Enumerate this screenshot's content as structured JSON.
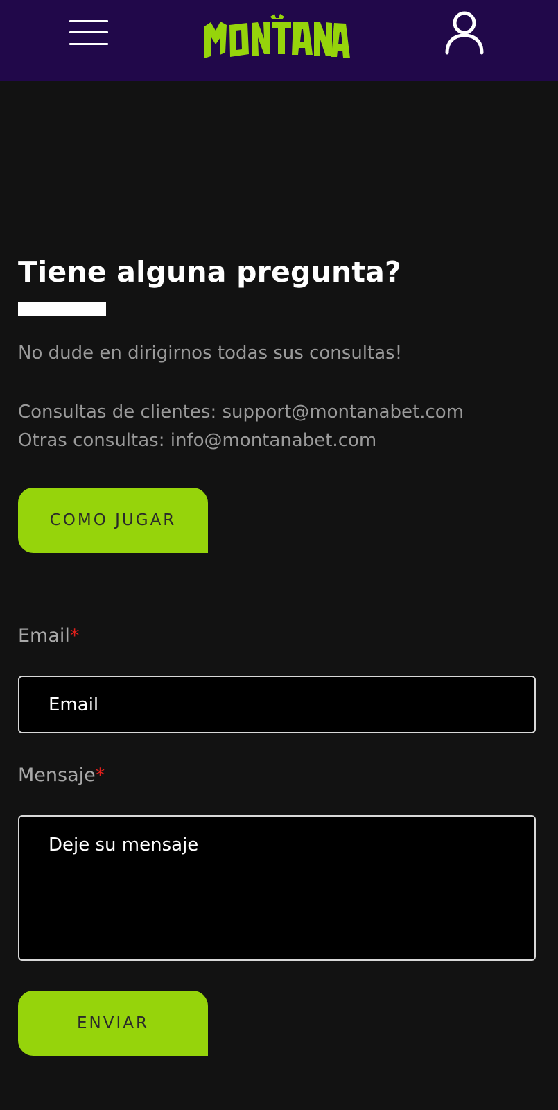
{
  "header": {
    "brand": "MONTANA",
    "menu_icon": "hamburger-menu-icon",
    "user_icon": "user-account-icon",
    "brand_color": "#96d40b",
    "background": "#21084a"
  },
  "contact": {
    "title": "Tiene alguna pregunta?",
    "intro": "No dude en dirigirnos todas sus consultas!",
    "clients_line": "Consultas de clientes: support@montanabet.com",
    "other_line": "Otras consultas: info@montanabet.com",
    "how_to_play_button": "COMO JUGAR"
  },
  "form": {
    "email_label": "Email",
    "email_placeholder": "Email",
    "message_label": "Mensaje",
    "message_placeholder": "Deje su mensaje",
    "required_mark": "*",
    "submit_button": "ENVIAR"
  },
  "colors": {
    "accent": "#96d40b",
    "required": "#e0201c",
    "page_background": "#121212"
  }
}
